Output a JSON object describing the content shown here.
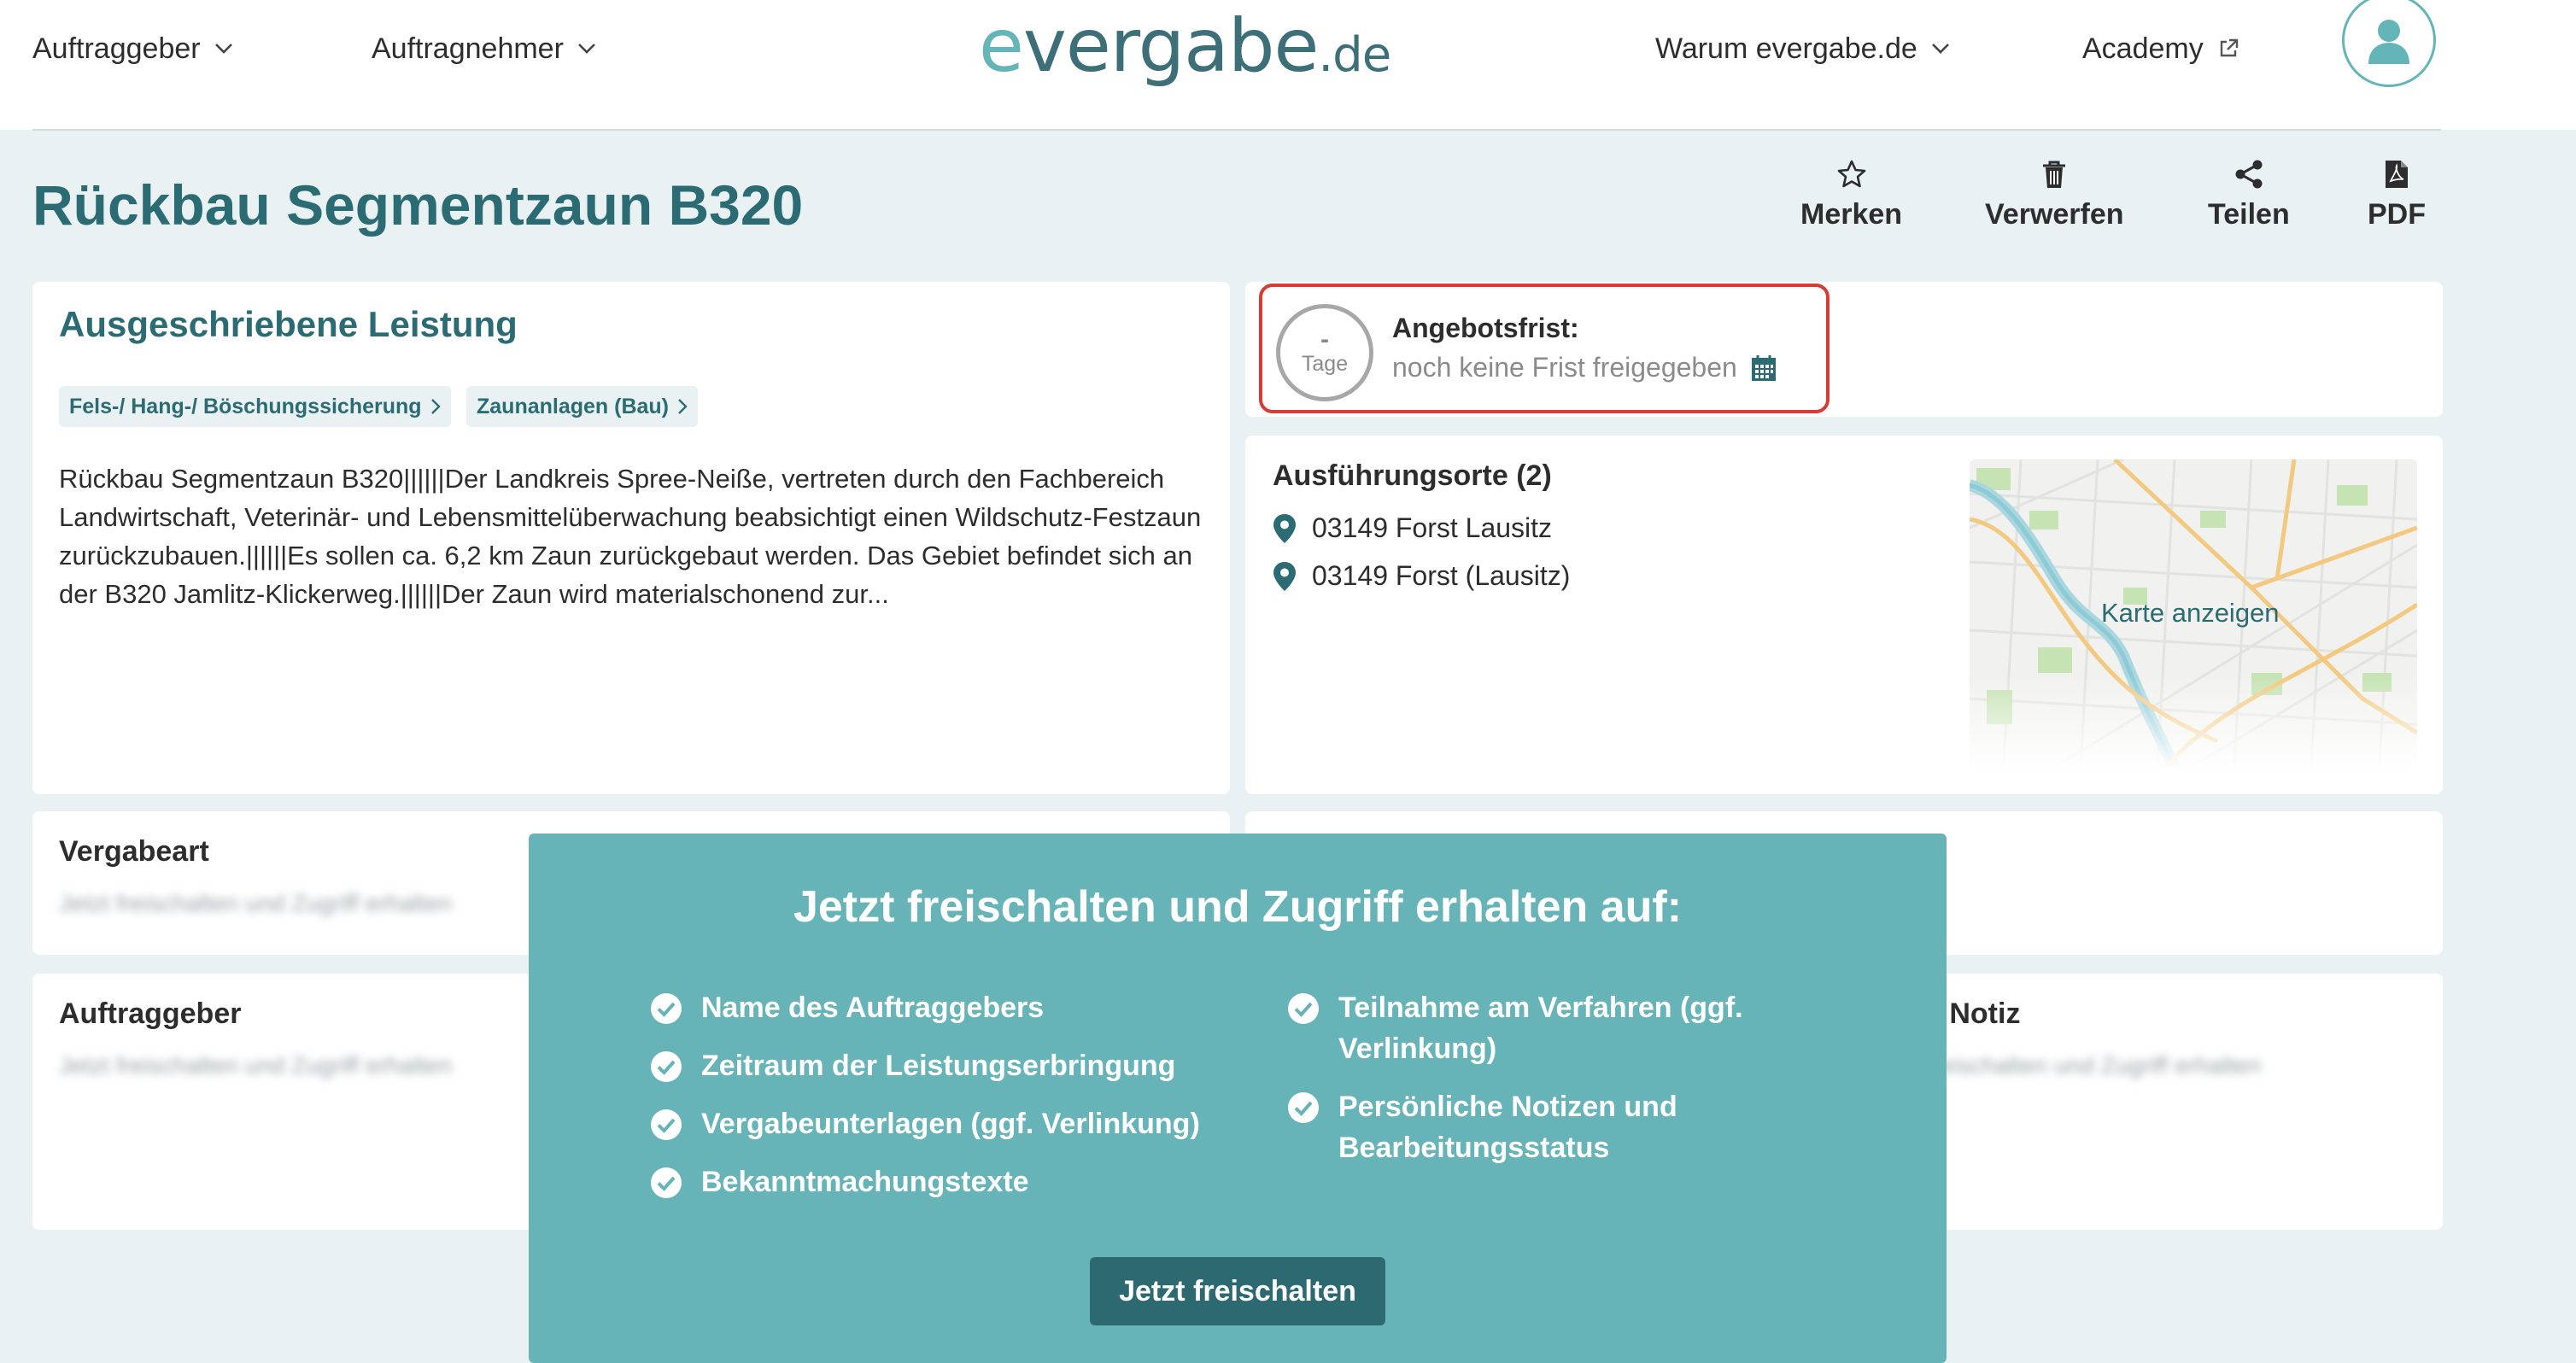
{
  "nav": {
    "auftraggeber": "Auftraggeber",
    "auftragnehmer": "Auftragnehmer",
    "warum": "Warum evergabe.de",
    "academy": "Academy",
    "logo_e": "e",
    "logo_main": "vergabe",
    "logo_tld": ".de"
  },
  "page": {
    "title": "Rückbau Segmentzaun B320"
  },
  "actions": {
    "merken": "Merken",
    "verwerfen": "Verwerfen",
    "teilen": "Teilen",
    "pdf": "PDF"
  },
  "leistung": {
    "heading": "Ausgeschriebene Leistung",
    "tags": [
      "Fels-/ Hang-/ Böschungssicherung",
      "Zaunanlagen (Bau)"
    ],
    "description": "Rückbau Segmentzaun B320||||||Der Landkreis Spree-Neiße, vertreten durch den Fachbereich Landwirtschaft, Veterinär- und Lebensmittelüberwachung beabsichtigt einen Wildschutz-Festzaun zurückzubauen.||||||Es sollen ca. 6,2 km Zaun zurückgebaut werden. Das Gebiet befindet sich an der B320 Jamlitz-Klickerweg.||||||Der Zaun wird materialschonend zur..."
  },
  "deadline": {
    "days": "-",
    "days_unit": "Tage",
    "label": "Angebotsfrist:",
    "text": "noch keine Frist freigegeben"
  },
  "locations": {
    "heading": "Ausführungsorte (2)",
    "items": [
      "03149 Forst Lausitz",
      "03149 Forst (Lausitz)"
    ],
    "map_label": "Karte anzeigen"
  },
  "vergabeart": {
    "heading": "Vergabeart",
    "blurred": "Jetzt freischalten und Zugriff erhalten"
  },
  "auftraggeber_card": {
    "heading": "Auftraggeber",
    "blurred": "Jetzt freischalten und Zugriff erhalten"
  },
  "notiz_card": {
    "heading_partial": "e Notiz",
    "blurred": "freischalten und Zugriff erhalten"
  },
  "overlay": {
    "title": "Jetzt freischalten und Zugriff erhalten auf:",
    "features_left": [
      "Name des Auftraggebers",
      "Zeitraum der Leistungserbringung",
      "Vergabeunterlagen (ggf. Verlinkung)",
      "Bekanntmachungstexte"
    ],
    "features_right": [
      "Teilnahme am Verfahren (ggf. Verlinkung)",
      "Persönliche Notizen und Bearbeitungsstatus"
    ],
    "cta": "Jetzt freischalten"
  },
  "colors": {
    "brand": "#2b6c74",
    "accent": "#66b4b7",
    "deadline_border": "#d93a33"
  }
}
